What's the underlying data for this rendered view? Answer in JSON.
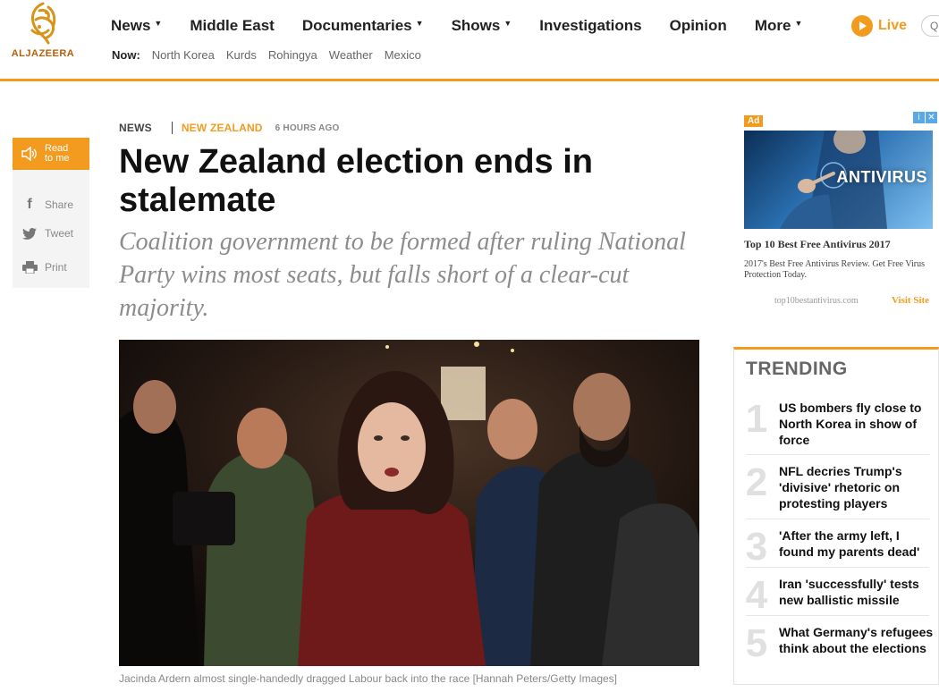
{
  "brand": {
    "name": "ALJAZEERA"
  },
  "nav": {
    "items": [
      {
        "label": "News",
        "caret": true
      },
      {
        "label": "Middle East",
        "caret": false
      },
      {
        "label": "Documentaries",
        "caret": true
      },
      {
        "label": "Shows",
        "caret": true
      },
      {
        "label": "Investigations",
        "caret": false
      },
      {
        "label": "Opinion",
        "caret": false
      },
      {
        "label": "More",
        "caret": true
      }
    ],
    "now_label": "Now:",
    "now_items": [
      "North Korea",
      "Kurds",
      "Rohingya",
      "Weather",
      "Mexico"
    ],
    "live_label": "Live"
  },
  "rail": {
    "read_label_1": "Read",
    "read_label_2": "to me",
    "share_label": "Share",
    "tweet_label": "Tweet",
    "print_label": "Print"
  },
  "article": {
    "section": "NEWS",
    "topic": "NEW ZEALAND",
    "time": "6 HOURS AGO",
    "headline": "New Zealand election ends in stalemate",
    "standfirst": "Coalition government to be formed after ruling National Party wins most seats, but falls short of a clear-cut majority.",
    "caption": "Jacinda Ardern almost single-handedly dragged Labour back into the race [Hannah Peters/Getty Images]"
  },
  "ad": {
    "badge": "Ad",
    "image_word": "ANTIVIRUS",
    "title": "Top 10 Best Free Antivirus 2017",
    "description": "2017's Best Free Antivirus Review. Get Free Virus Protection Today.",
    "url": "top10bestantivirus.com",
    "cta": "Visit Site"
  },
  "trending": {
    "title": "TRENDING",
    "items": [
      {
        "num": "1",
        "text": "US bombers fly close to North Korea in show of force"
      },
      {
        "num": "2",
        "text": "NFL decries Trump's 'divisive' rhetoric on protesting players"
      },
      {
        "num": "3",
        "text": "'After the army left, I found my parents dead'"
      },
      {
        "num": "4",
        "text": "Iran 'successfully' tests new ballistic missile"
      },
      {
        "num": "5",
        "text": "What Germany's refugees think about the elections"
      }
    ]
  },
  "colors": {
    "accent": "#f29b1f",
    "text": "#111111",
    "muted": "#8c8c8c"
  }
}
